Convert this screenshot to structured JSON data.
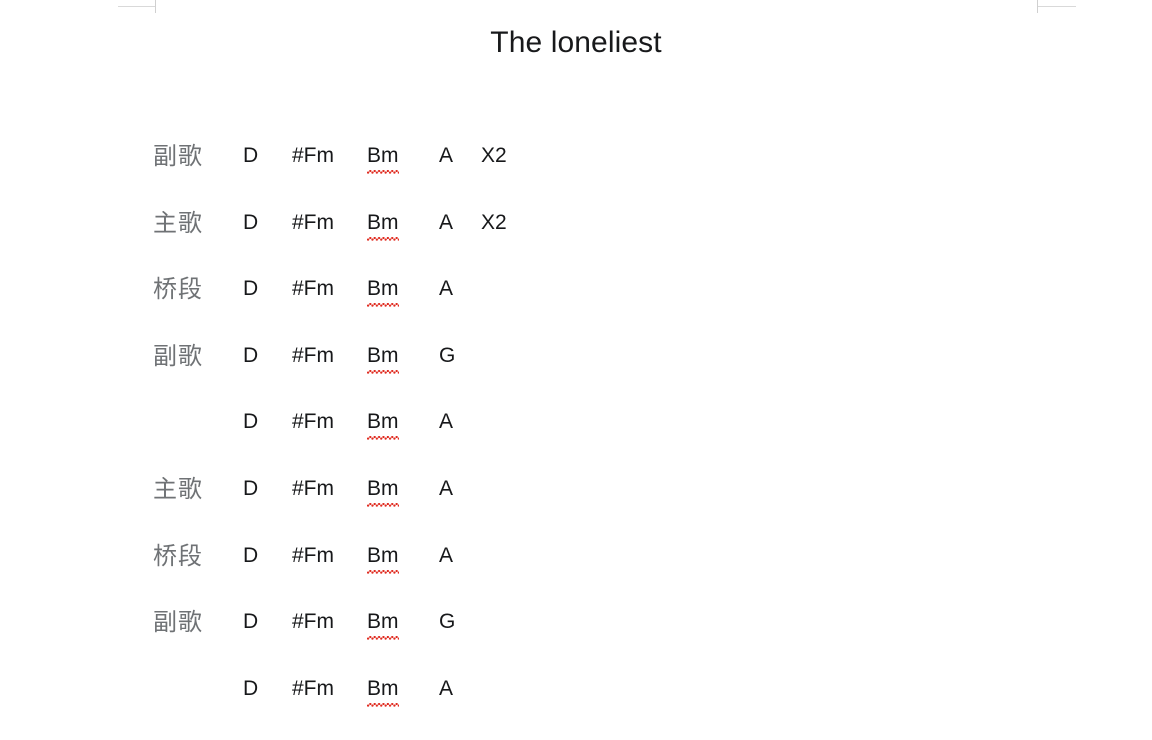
{
  "document": {
    "title": "The loneliest"
  },
  "margin_markers": {
    "left_label": "left-margin-corner",
    "right_label": "right-margin-corner"
  },
  "chart": {
    "columns": [
      "section",
      "chord1",
      "chord2",
      "chord3",
      "chord4",
      "repeat"
    ],
    "rows": [
      {
        "section": "副歌",
        "chord1": "D",
        "chord2": "#Fm",
        "chord3": "Bm",
        "chord4": "A",
        "repeat": "X2"
      },
      {
        "section": "主歌",
        "chord1": "D",
        "chord2": "#Fm",
        "chord3": "Bm",
        "chord4": "A",
        "repeat": "X2"
      },
      {
        "section": "桥段",
        "chord1": "D",
        "chord2": "#Fm",
        "chord3": "Bm",
        "chord4": "A",
        "repeat": ""
      },
      {
        "section": "副歌",
        "chord1": "D",
        "chord2": "#Fm",
        "chord3": "Bm",
        "chord4": "G",
        "repeat": ""
      },
      {
        "section": "",
        "chord1": "D",
        "chord2": "#Fm",
        "chord3": "Bm",
        "chord4": "A",
        "repeat": ""
      },
      {
        "section": "主歌",
        "chord1": "D",
        "chord2": "#Fm",
        "chord3": "Bm",
        "chord4": "A",
        "repeat": ""
      },
      {
        "section": "桥段",
        "chord1": "D",
        "chord2": "#Fm",
        "chord3": "Bm",
        "chord4": "A",
        "repeat": ""
      },
      {
        "section": "副歌",
        "chord1": "D",
        "chord2": "#Fm",
        "chord3": "Bm",
        "chord4": "G",
        "repeat": ""
      },
      {
        "section": "",
        "chord1": "D",
        "chord2": "#Fm",
        "chord3": "Bm",
        "chord4": "A",
        "repeat": ""
      }
    ]
  },
  "colors": {
    "page_background": "#ffffff",
    "title_text": "#18191b",
    "section_label_text": "#6f7275",
    "chord_text": "#17181a",
    "spellcheck_underline": "#e02b20",
    "margin_marker": "#d9d9d9"
  }
}
